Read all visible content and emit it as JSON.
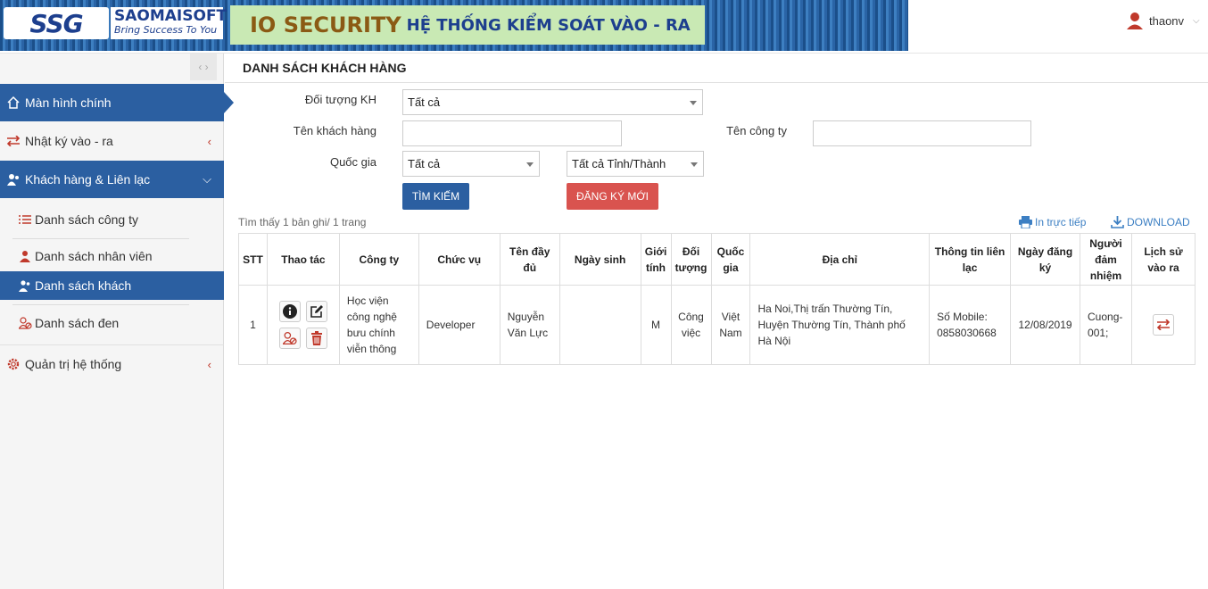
{
  "header": {
    "logo_ssg": "SSG",
    "brand_name": "SAOMAISOFT",
    "brand_tagline": "Bring Success To You",
    "title_big": "IO SECURITY",
    "title_small": "HỆ THỐNG KIỂM SOÁT VÀO - RA",
    "username": "thaonv"
  },
  "sidebar": {
    "toggle": "‹ ›",
    "items": [
      {
        "label": "Màn hình chính",
        "icon": "home-icon"
      },
      {
        "label": "Nhật ký vào - ra",
        "icon": "exchange-icon"
      },
      {
        "label": "Khách hàng & Liên lạc",
        "icon": "users-icon"
      },
      {
        "label": "Quản trị hệ thống",
        "icon": "gear-icon"
      }
    ],
    "subitems": [
      {
        "label": "Danh sách công ty",
        "icon": "list-icon"
      },
      {
        "label": "Danh sách nhân viên",
        "icon": "user-icon"
      },
      {
        "label": "Danh sách khách",
        "icon": "user-group-icon"
      },
      {
        "label": "Danh sách đen",
        "icon": "blacklist-icon"
      }
    ]
  },
  "page": {
    "title": "DANH SÁCH KHÁCH HÀNG"
  },
  "filters": {
    "customer_type_label": "Đối tượng KH",
    "customer_type_value": "Tất cả",
    "customer_name_label": "Tên khách hàng",
    "customer_name_value": "",
    "company_label": "Tên công ty",
    "company_value": "",
    "country_label": "Quốc gia",
    "country_value": "Tất cả",
    "province_value": "Tất cả Tỉnh/Thành",
    "search_button": "TÌM KIẾM",
    "register_button": "ĐĂNG KÝ MỚI"
  },
  "results": {
    "found_text": "Tìm thấy 1 bản ghi/ 1 trang",
    "print_link": "In trực tiếp",
    "download_link": "DOWNLOAD"
  },
  "table": {
    "headers": [
      "STT",
      "Thao tác",
      "Công ty",
      "Chức vụ",
      "Tên đầy đủ",
      "Ngày sinh",
      "Giới tính",
      "Đối tượng",
      "Quốc gia",
      "Địa chỉ",
      "Thông tin liên lạc",
      "Ngày đăng ký",
      "Người đảm nhiệm",
      "Lịch sử vào ra"
    ],
    "rows": [
      {
        "stt": "1",
        "company": "Học viện công nghệ bưu chính viễn thông",
        "position": "Developer",
        "full_name": "Nguyễn Văn Lực",
        "birthday": "",
        "gender": "M",
        "type": "Công việc",
        "country": "Việt Nam",
        "address": "Ha Noi,Thị trấn Thường Tín, Huyện Thường Tín, Thành phố Hà Nội",
        "contact": "Số Mobile: 0858030668",
        "register_date": "12/08/2019",
        "handler": "Cuong-001;"
      }
    ]
  },
  "colors": {
    "primary": "#2b5fa1",
    "danger": "#d9534f",
    "link": "#3c7fc3"
  }
}
